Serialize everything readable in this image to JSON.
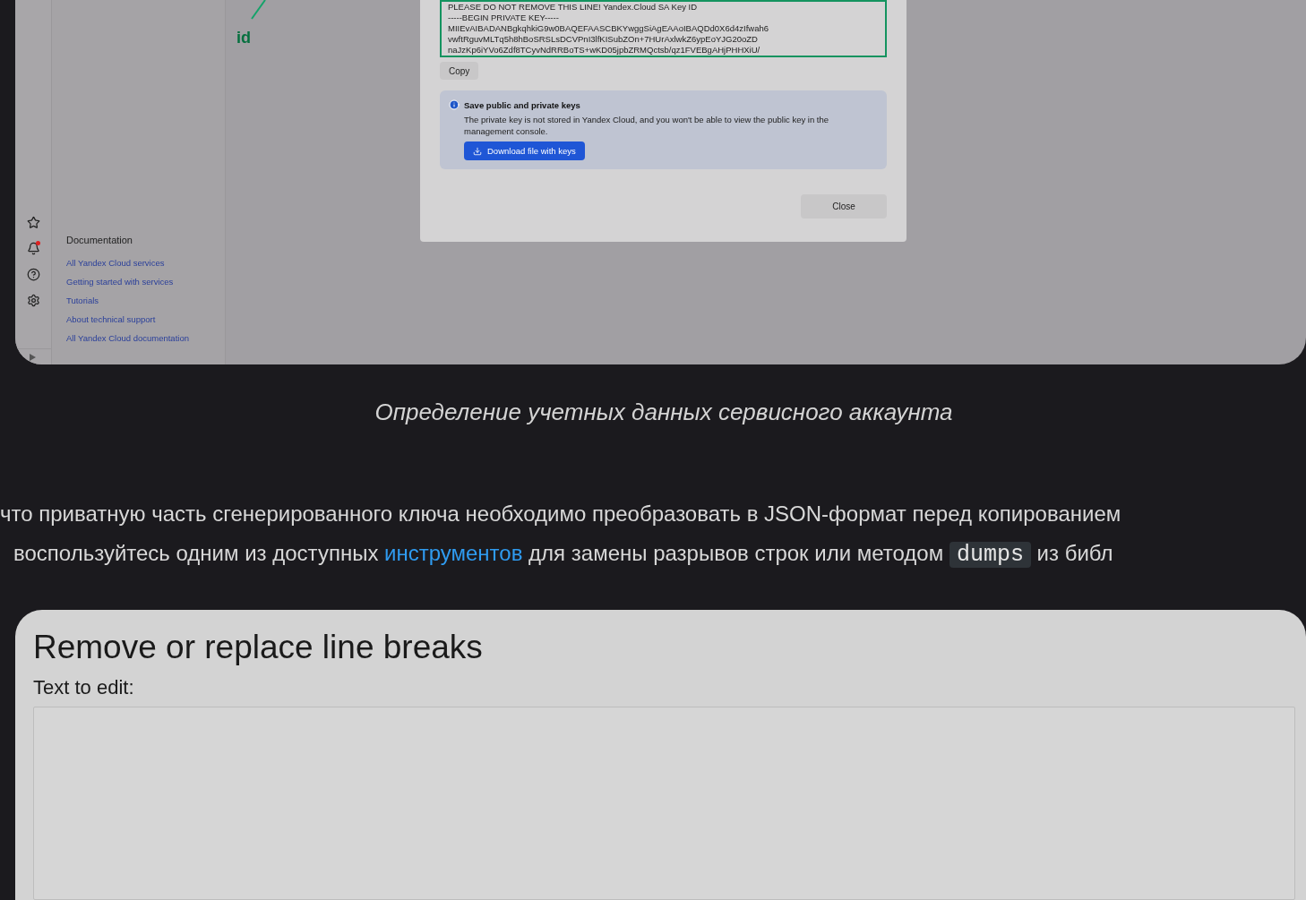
{
  "screenshot_top": {
    "annotation": {
      "label": "id"
    },
    "key_dialog": {
      "key_lines": [
        "PLEASE DO NOT REMOVE THIS LINE! Yandex.Cloud SA Key ID",
        "-----BEGIN PRIVATE KEY-----",
        "MIIEvAIBADANBgkqhkiG9w0BAQEFAASCBKYwggSiAgEAAoIBAQDd0X6d4zIfwah6",
        "vwftRguvMLTq5h8hBoSRSLsDCVPnI3lfKISubZOn+7HUrAxlwkZ6ypEoYJG20oZD",
        "naJzKp6iYVo6Zdf8TCyvNdRRBoTS+wKD05jpbZRMQctsb/qz1FVEBgAHjPHHXiU/"
      ],
      "copy_button": "Copy",
      "notice": {
        "title": "Save public and private keys",
        "text": "The private key is not stored in Yandex Cloud, and you won't be able to view the public key in the management console.",
        "button": "Download file with keys"
      },
      "close_button": "Close"
    },
    "sidebar": {
      "section_title": "Documentation",
      "links": [
        "All Yandex Cloud services",
        "Getting started with services",
        "Tutorials",
        "About technical support",
        "All Yandex Cloud documentation"
      ]
    }
  },
  "caption": "Определение учетных данных сервисного аккаунта",
  "paragraph": {
    "lines": [
      [
        {
          "kind": "text",
          "text": "что приватную часть сгенерированного ключа необходимо преобразовать в JSON-формат перед копированием"
        }
      ],
      [
        {
          "kind": "text",
          "text": "воспользуйтесь одним из доступных "
        },
        {
          "kind": "link",
          "text": "инструментов"
        },
        {
          "kind": "text",
          "text": " для замены разрывов строк или методом "
        },
        {
          "kind": "code",
          "text": "dumps"
        },
        {
          "kind": "text",
          "text": " из библ"
        }
      ]
    ]
  },
  "screenshot_bottom": {
    "title": "Remove or replace line breaks",
    "field_label": "Text to edit:"
  }
}
